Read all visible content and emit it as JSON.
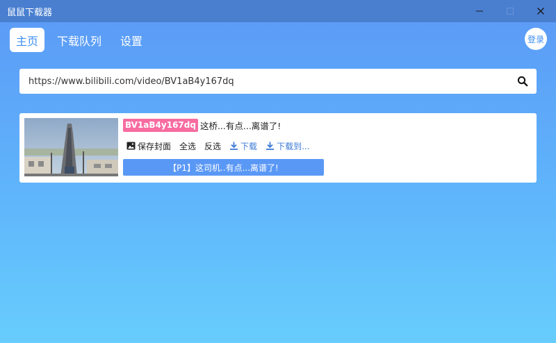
{
  "window": {
    "title": "鼠鼠下载器",
    "controls": [
      "minimize",
      "maximize",
      "close"
    ]
  },
  "nav": {
    "tabs": [
      {
        "label": "主页",
        "active": true
      },
      {
        "label": "下载队列",
        "active": false
      },
      {
        "label": "设置",
        "active": false
      }
    ],
    "login_label": "登录"
  },
  "search": {
    "value": "https://www.bilibili.com/video/BV1aB4y167dq",
    "icon": "search-icon"
  },
  "video": {
    "bvid": "BV1aB4y167dq",
    "title": "这桥...有点...离谱了!",
    "actions": {
      "save_cover": "保存封面",
      "select_all": "全选",
      "invert_select": "反选",
      "download": "下载",
      "download_to": "下载到..."
    },
    "parts": [
      {
        "label": "【P1】这司机..有点...离谱了!"
      }
    ]
  },
  "colors": {
    "accent": "#3d8ef2",
    "badge": "#f86ca0",
    "part_bar": "#5a98f6",
    "titlebar": "#4a7fd0"
  }
}
